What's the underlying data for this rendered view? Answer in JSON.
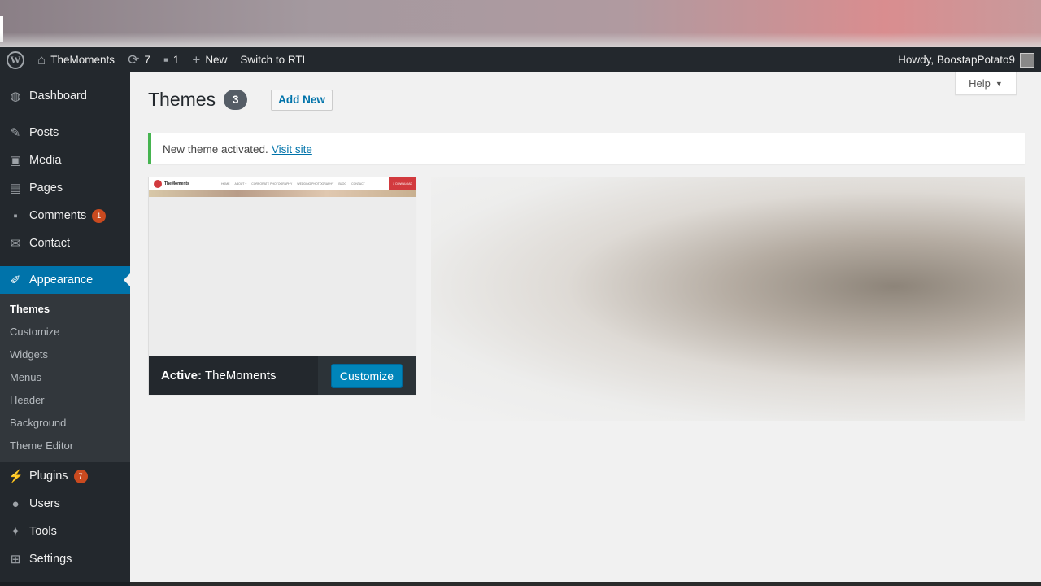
{
  "adminbar": {
    "site_name": "TheMoments",
    "updates_count": "7",
    "comments_count": "1",
    "new_label": "New",
    "rtl_label": "Switch to RTL",
    "greeting": "Howdy, BoostapPotato9"
  },
  "sidebar": {
    "items": [
      {
        "label": "Dashboard",
        "icon": "dashboard-icon"
      },
      {
        "label": "Posts",
        "icon": "pin-icon"
      },
      {
        "label": "Media",
        "icon": "media-icon"
      },
      {
        "label": "Pages",
        "icon": "pages-icon"
      },
      {
        "label": "Comments",
        "icon": "comment-icon",
        "badge": "1"
      },
      {
        "label": "Contact",
        "icon": "mail-icon"
      },
      {
        "label": "Appearance",
        "icon": "brush-icon"
      },
      {
        "label": "Plugins",
        "icon": "plugin-icon",
        "badge": "7"
      },
      {
        "label": "Users",
        "icon": "user-icon"
      },
      {
        "label": "Tools",
        "icon": "wrench-icon"
      },
      {
        "label": "Settings",
        "icon": "settings-icon"
      }
    ],
    "submenu": [
      "Themes",
      "Customize",
      "Widgets",
      "Menus",
      "Header",
      "Background",
      "Theme Editor"
    ]
  },
  "main": {
    "title": "Themes",
    "theme_count": "3",
    "add_new_label": "Add New",
    "help_label": "Help",
    "notice_text": "New theme activated.",
    "notice_link": "Visit site",
    "active_prefix": "Active:",
    "active_theme": "TheMoments",
    "customize_label": "Customize"
  },
  "preview": {
    "site_name": "TheMoments",
    "nav": [
      "HOME",
      "ABOUT ▾",
      "CORPORATE PHOTOGRAPHY",
      "WEDDING PHOTOGRAPHY",
      "BLOG",
      "CONTACT"
    ],
    "download": "⇩ DOWNLOAD"
  },
  "colors": {
    "adminbar": "#23282d",
    "accent": "#0073aa",
    "notice_success": "#46b450",
    "badge": "#ca4a1f"
  }
}
